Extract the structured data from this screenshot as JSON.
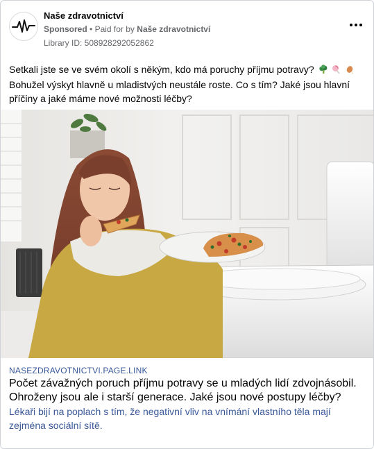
{
  "header": {
    "page_name": "Naše zdravotnictví",
    "sponsored_label": "Sponsored",
    "paid_for_prefix": "Paid for by",
    "paid_for_name": "Naše zdravotnictví",
    "library_id": "Library ID: 508928292052862",
    "logo_icon": "pulse-line-icon",
    "menu_icon": "more-options-icon"
  },
  "body": {
    "text_line1": "Setkali jste se ve svém okolí s někým, kdo má poruchy příjmu potravy?",
    "text_rest": "Bohužel výskyt hlavně u mladistvých neustále roste. Co s tím? Jaké jsou hlavní příčiny a jaké máme nové možnosti léčby?",
    "emojis": [
      "broccoli-emoji",
      "lollipop-emoji",
      "chicken-leg-emoji"
    ]
  },
  "image": {
    "subject": "woman-eating-pizza-next-to-toilet"
  },
  "link_card": {
    "domain": "NASEZDRAVOTNICTVI.PAGE.LINK",
    "title": "Počet závažných poruch příjmu potravy se u mladých lidí zdvojnásobil. Ohroženy jsou ale i starší generace. Jaké jsou nové postupy léčby?",
    "description": "Lékaři bijí na poplach s tím, že negativní vliv na vnímání vlastního těla mají zejména sociální sítě."
  },
  "colors": {
    "link_blue": "#385898",
    "secondary_text": "#65676b",
    "primary_text": "#050505"
  }
}
